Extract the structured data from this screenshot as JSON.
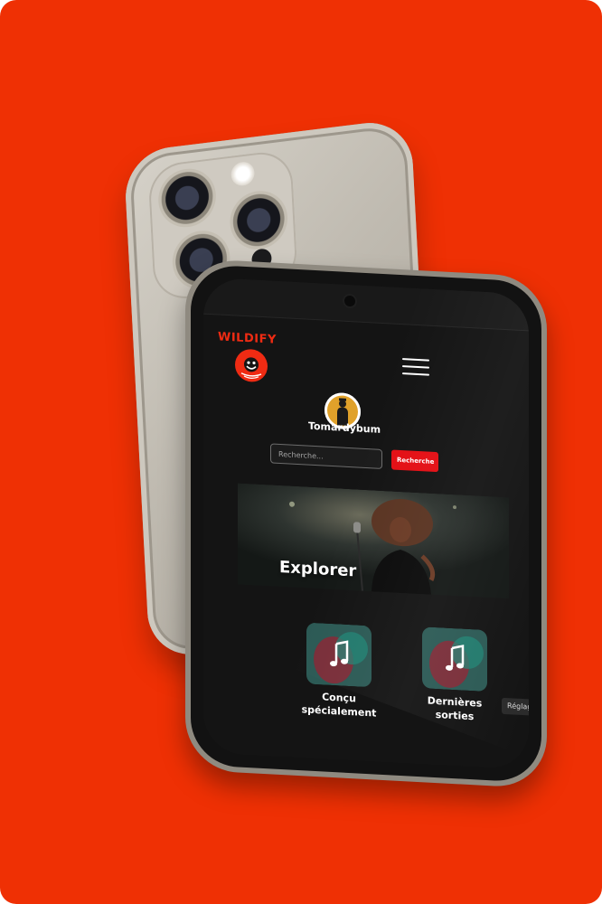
{
  "app": {
    "logo_text": "WILDIFY"
  },
  "user": {
    "name": "Tomardybum"
  },
  "search": {
    "placeholder": "Recherche...",
    "button_label": "Recherche"
  },
  "hero": {
    "caption": "Explorer"
  },
  "cards": [
    {
      "label_line1": "Conçu",
      "label_line2": "spécialement",
      "icon": "music-note-icon"
    },
    {
      "label_line1": "Dernières",
      "label_line2": "sorties",
      "icon": "music-note-icon"
    }
  ],
  "settings": {
    "label": "Réglages"
  },
  "colors": {
    "background": "#ef3004",
    "accent": "#e40e14",
    "screen": "#141414"
  }
}
